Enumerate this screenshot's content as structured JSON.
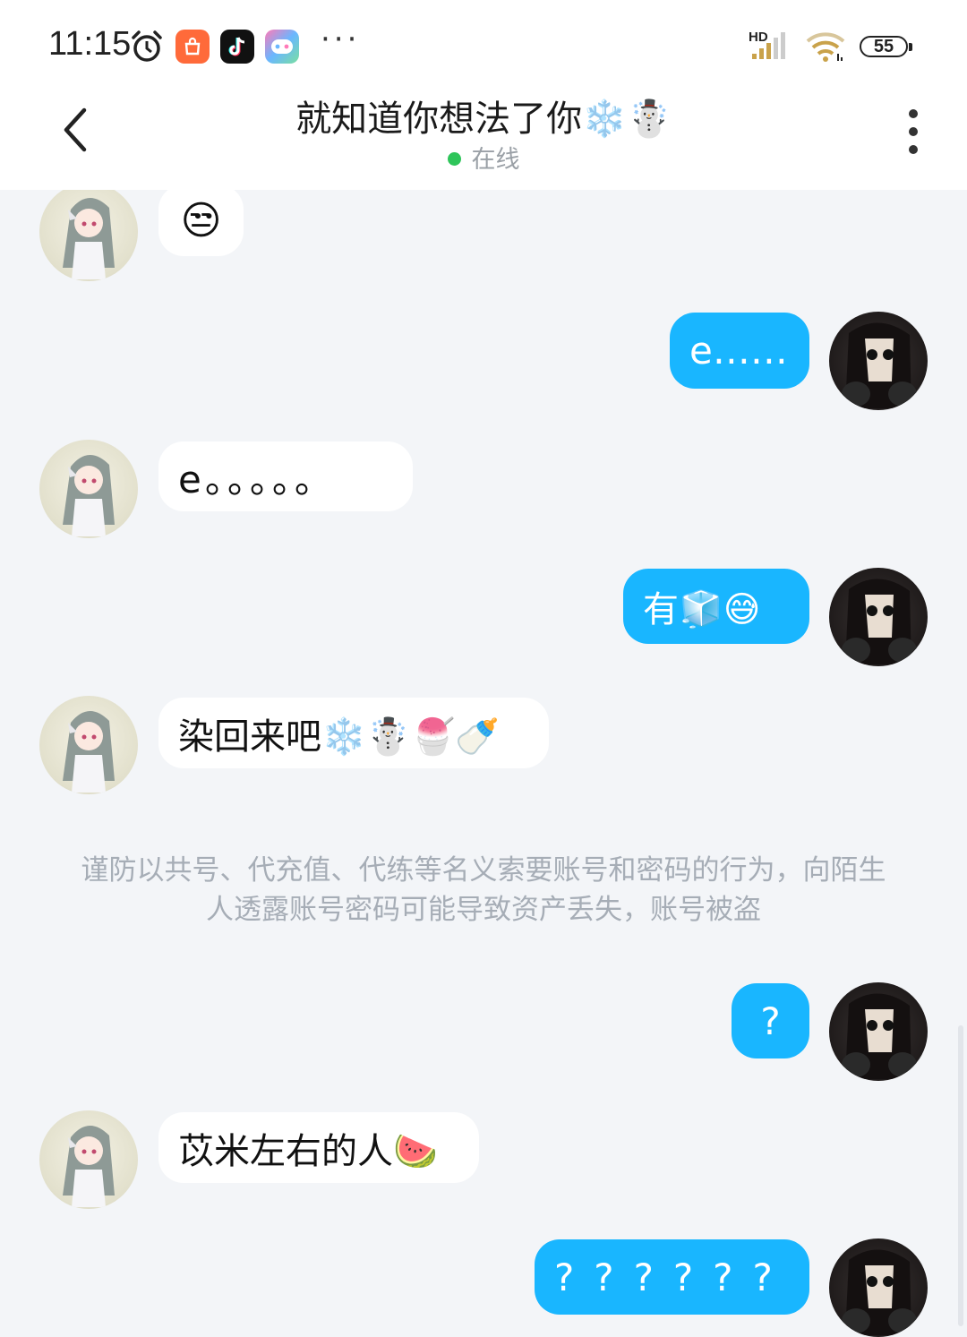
{
  "status_bar": {
    "time": "11:15",
    "network": "HD",
    "battery": "55",
    "icons": [
      "alarm-icon",
      "mall-app-icon",
      "tiktok-app-icon",
      "game-app-icon",
      "more-icon",
      "signal-icon",
      "wifi-icon",
      "battery-icon"
    ]
  },
  "header": {
    "title": "就知道你想法了你❄️☃️",
    "status": "在线",
    "back_icon": "chevron-left-icon",
    "menu_icon": "more-vertical-icon"
  },
  "messages": [
    {
      "from": "friend",
      "text": "😒"
    },
    {
      "from": "me",
      "text": "e……"
    },
    {
      "from": "friend",
      "text": "e。。。。。"
    },
    {
      "from": "me",
      "text": "有🧊😅"
    },
    {
      "from": "friend",
      "text": "染回来吧❄️☃️🍧🍼"
    },
    {
      "from": "me",
      "text": "?"
    },
    {
      "from": "friend",
      "text": "苡米左右的人🍉"
    },
    {
      "from": "me",
      "text": "??????"
    }
  ],
  "notice": "谨防以共号、代充值、代练等名义索要账号和密码的行为，向陌生人透露账号密码可能导致资产丢失，账号被盗",
  "colors": {
    "background": "#f3f5f8",
    "outgoing_bubble": "#19b6ff",
    "incoming_bubble": "#ffffff",
    "online_dot": "#2ec55a",
    "notice_text": "#a6adb6"
  }
}
